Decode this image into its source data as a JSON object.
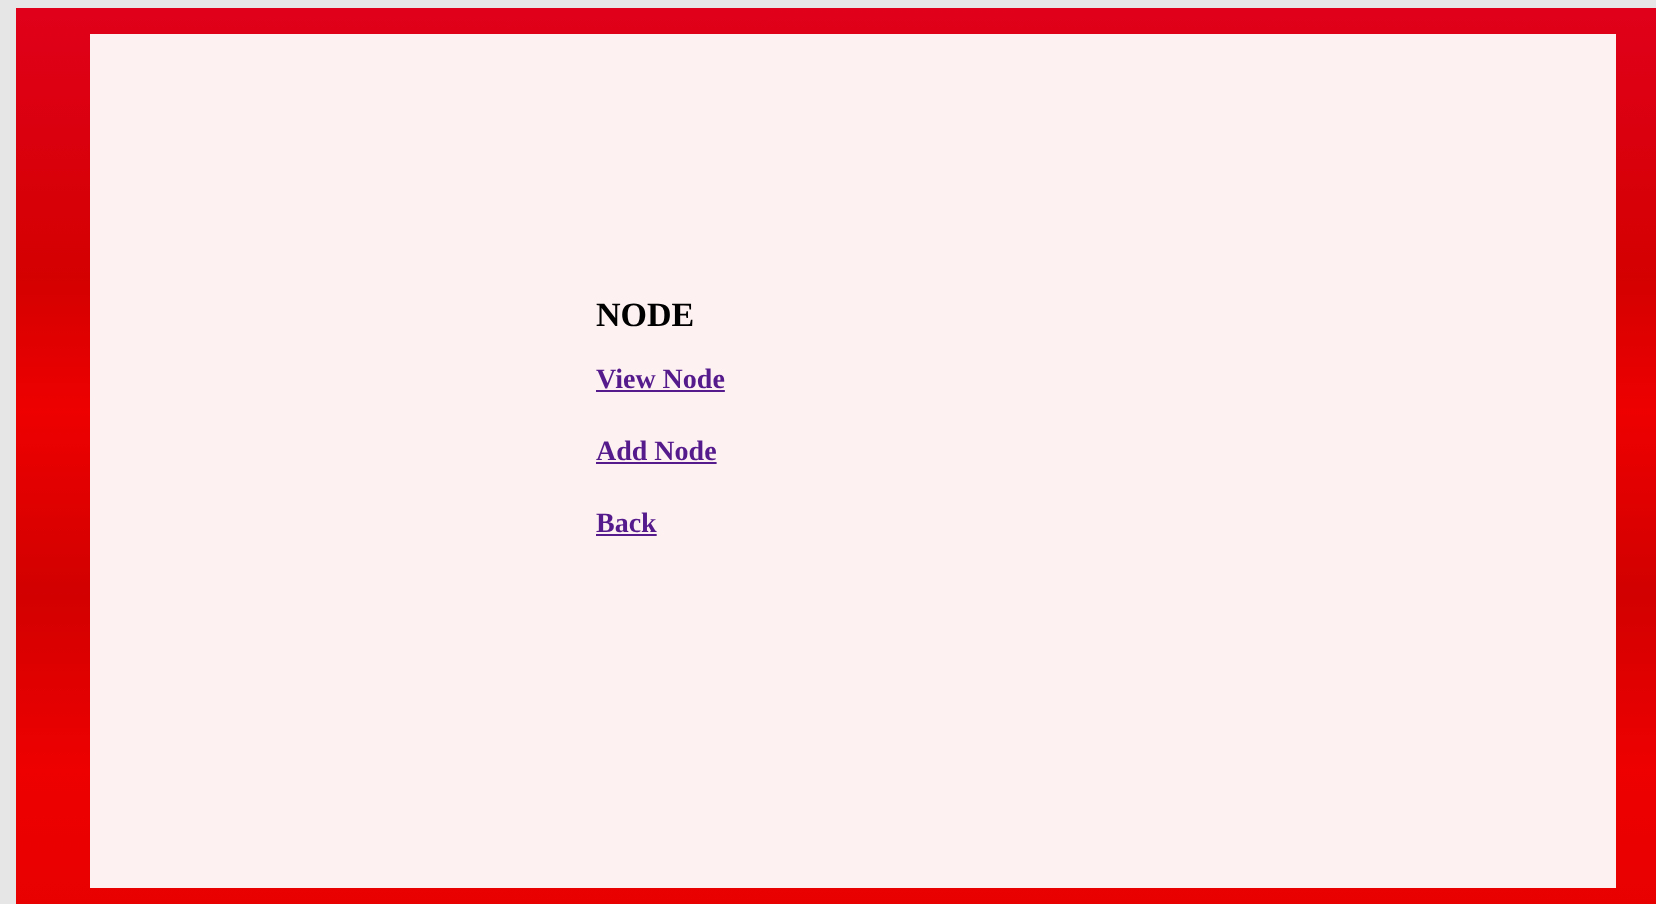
{
  "heading": "NODE",
  "links": [
    {
      "label": "View Node"
    },
    {
      "label": "Add Node"
    },
    {
      "label": "Back"
    }
  ]
}
